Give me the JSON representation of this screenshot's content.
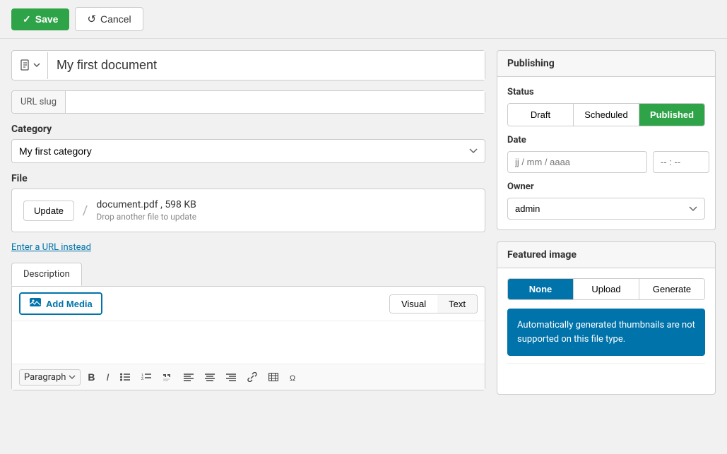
{
  "toolbar": {
    "save_label": "Save",
    "cancel_label": "Cancel"
  },
  "title_input": {
    "value": "My first document",
    "placeholder": "My first document"
  },
  "url_slug": {
    "label": "URL slug",
    "value": ""
  },
  "category": {
    "label": "Category",
    "selected": "My first category",
    "options": [
      "My first category"
    ]
  },
  "file_section": {
    "label": "File",
    "update_btn": "Update",
    "file_name": "document.pdf , 598 KB",
    "drop_hint": "Drop another file to update"
  },
  "url_link": {
    "label": "Enter a URL instead"
  },
  "description": {
    "tab_label": "Description",
    "add_media_btn": "Add Media",
    "view_tabs": [
      "Visual",
      "Text"
    ],
    "active_view": "Visual",
    "paragraph_label": "Paragraph"
  },
  "publishing": {
    "panel_title": "Publishing",
    "status_label": "Status",
    "status_options": [
      "Draft",
      "Scheduled",
      "Published"
    ],
    "active_status": "Published",
    "date_label": "Date",
    "date_placeholder": "jj / mm / aaaa",
    "time_placeholder": "-- : --",
    "owner_label": "Owner",
    "owner_selected": "admin",
    "owner_options": [
      "admin"
    ]
  },
  "featured_image": {
    "panel_title": "Featured image",
    "options": [
      "None",
      "Upload",
      "Generate"
    ],
    "active_option": "None",
    "notice": "Automatically generated thumbnails are not supported on this file type."
  },
  "toolbar_buttons": [
    "B",
    "I",
    "≡",
    "≡",
    "❝",
    "≡",
    "≡",
    "≡",
    "🔗",
    "⊞",
    "✦"
  ]
}
